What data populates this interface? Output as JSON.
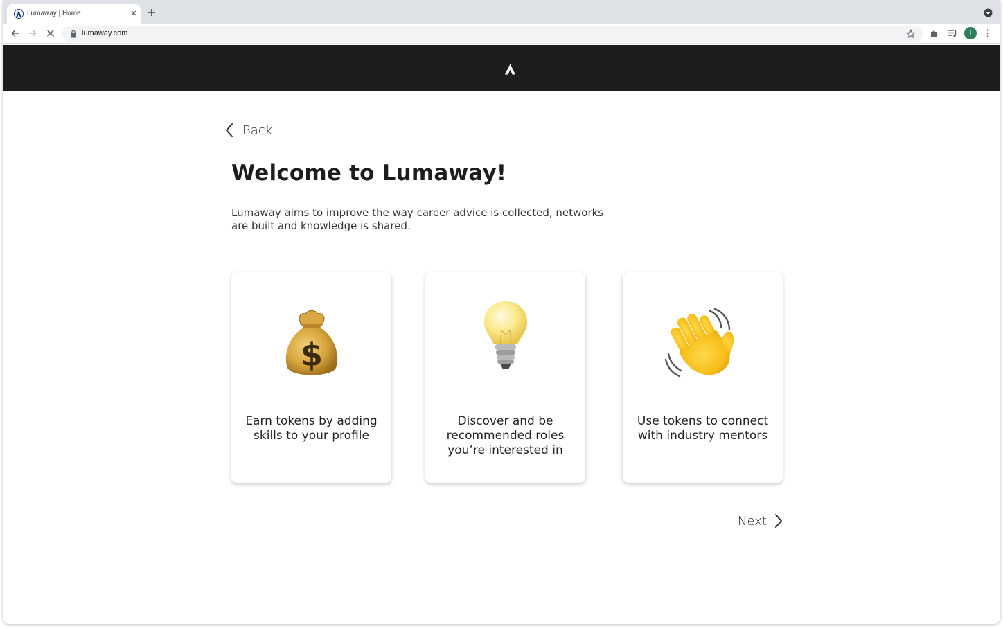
{
  "browser": {
    "tab_title": "Lumaway | Home",
    "url": "lumaway.com",
    "profile_initial": "I"
  },
  "page": {
    "back_label": "Back",
    "heading": "Welcome to Lumaway!",
    "intro": "Lumaway aims to improve the way career advice is collected, networks are built and knowledge is shared.",
    "cards": [
      {
        "icon": "money-bag-icon",
        "caption": "Earn tokens by adding skills to your profile"
      },
      {
        "icon": "light-bulb-icon",
        "caption": "Discover and be recommended roles you’re interested in"
      },
      {
        "icon": "waving-hand-icon",
        "caption": "Use tokens to connect with industry mentors"
      }
    ],
    "next_label": "Next"
  },
  "colors": {
    "header_bg": "#1d1d1f",
    "tabstrip_bg": "#dee1e6",
    "avatar_bg": "#2e7d5b"
  }
}
